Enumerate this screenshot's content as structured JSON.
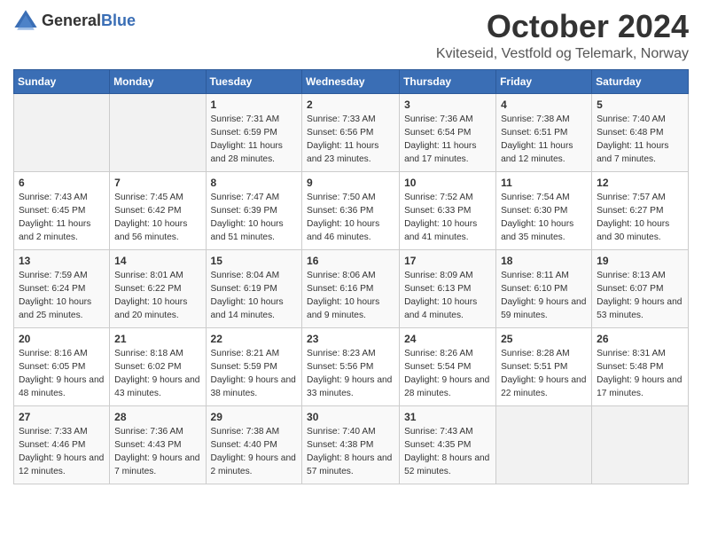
{
  "header": {
    "logo_general": "General",
    "logo_blue": "Blue",
    "month_title": "October 2024",
    "location": "Kviteseid, Vestfold og Telemark, Norway"
  },
  "weekdays": [
    "Sunday",
    "Monday",
    "Tuesday",
    "Wednesday",
    "Thursday",
    "Friday",
    "Saturday"
  ],
  "weeks": [
    [
      {
        "day": "",
        "info": ""
      },
      {
        "day": "",
        "info": ""
      },
      {
        "day": "1",
        "info": "Sunrise: 7:31 AM\nSunset: 6:59 PM\nDaylight: 11 hours and 28 minutes."
      },
      {
        "day": "2",
        "info": "Sunrise: 7:33 AM\nSunset: 6:56 PM\nDaylight: 11 hours and 23 minutes."
      },
      {
        "day": "3",
        "info": "Sunrise: 7:36 AM\nSunset: 6:54 PM\nDaylight: 11 hours and 17 minutes."
      },
      {
        "day": "4",
        "info": "Sunrise: 7:38 AM\nSunset: 6:51 PM\nDaylight: 11 hours and 12 minutes."
      },
      {
        "day": "5",
        "info": "Sunrise: 7:40 AM\nSunset: 6:48 PM\nDaylight: 11 hours and 7 minutes."
      }
    ],
    [
      {
        "day": "6",
        "info": "Sunrise: 7:43 AM\nSunset: 6:45 PM\nDaylight: 11 hours and 2 minutes."
      },
      {
        "day": "7",
        "info": "Sunrise: 7:45 AM\nSunset: 6:42 PM\nDaylight: 10 hours and 56 minutes."
      },
      {
        "day": "8",
        "info": "Sunrise: 7:47 AM\nSunset: 6:39 PM\nDaylight: 10 hours and 51 minutes."
      },
      {
        "day": "9",
        "info": "Sunrise: 7:50 AM\nSunset: 6:36 PM\nDaylight: 10 hours and 46 minutes."
      },
      {
        "day": "10",
        "info": "Sunrise: 7:52 AM\nSunset: 6:33 PM\nDaylight: 10 hours and 41 minutes."
      },
      {
        "day": "11",
        "info": "Sunrise: 7:54 AM\nSunset: 6:30 PM\nDaylight: 10 hours and 35 minutes."
      },
      {
        "day": "12",
        "info": "Sunrise: 7:57 AM\nSunset: 6:27 PM\nDaylight: 10 hours and 30 minutes."
      }
    ],
    [
      {
        "day": "13",
        "info": "Sunrise: 7:59 AM\nSunset: 6:24 PM\nDaylight: 10 hours and 25 minutes."
      },
      {
        "day": "14",
        "info": "Sunrise: 8:01 AM\nSunset: 6:22 PM\nDaylight: 10 hours and 20 minutes."
      },
      {
        "day": "15",
        "info": "Sunrise: 8:04 AM\nSunset: 6:19 PM\nDaylight: 10 hours and 14 minutes."
      },
      {
        "day": "16",
        "info": "Sunrise: 8:06 AM\nSunset: 6:16 PM\nDaylight: 10 hours and 9 minutes."
      },
      {
        "day": "17",
        "info": "Sunrise: 8:09 AM\nSunset: 6:13 PM\nDaylight: 10 hours and 4 minutes."
      },
      {
        "day": "18",
        "info": "Sunrise: 8:11 AM\nSunset: 6:10 PM\nDaylight: 9 hours and 59 minutes."
      },
      {
        "day": "19",
        "info": "Sunrise: 8:13 AM\nSunset: 6:07 PM\nDaylight: 9 hours and 53 minutes."
      }
    ],
    [
      {
        "day": "20",
        "info": "Sunrise: 8:16 AM\nSunset: 6:05 PM\nDaylight: 9 hours and 48 minutes."
      },
      {
        "day": "21",
        "info": "Sunrise: 8:18 AM\nSunset: 6:02 PM\nDaylight: 9 hours and 43 minutes."
      },
      {
        "day": "22",
        "info": "Sunrise: 8:21 AM\nSunset: 5:59 PM\nDaylight: 9 hours and 38 minutes."
      },
      {
        "day": "23",
        "info": "Sunrise: 8:23 AM\nSunset: 5:56 PM\nDaylight: 9 hours and 33 minutes."
      },
      {
        "day": "24",
        "info": "Sunrise: 8:26 AM\nSunset: 5:54 PM\nDaylight: 9 hours and 28 minutes."
      },
      {
        "day": "25",
        "info": "Sunrise: 8:28 AM\nSunset: 5:51 PM\nDaylight: 9 hours and 22 minutes."
      },
      {
        "day": "26",
        "info": "Sunrise: 8:31 AM\nSunset: 5:48 PM\nDaylight: 9 hours and 17 minutes."
      }
    ],
    [
      {
        "day": "27",
        "info": "Sunrise: 7:33 AM\nSunset: 4:46 PM\nDaylight: 9 hours and 12 minutes."
      },
      {
        "day": "28",
        "info": "Sunrise: 7:36 AM\nSunset: 4:43 PM\nDaylight: 9 hours and 7 minutes."
      },
      {
        "day": "29",
        "info": "Sunrise: 7:38 AM\nSunset: 4:40 PM\nDaylight: 9 hours and 2 minutes."
      },
      {
        "day": "30",
        "info": "Sunrise: 7:40 AM\nSunset: 4:38 PM\nDaylight: 8 hours and 57 minutes."
      },
      {
        "day": "31",
        "info": "Sunrise: 7:43 AM\nSunset: 4:35 PM\nDaylight: 8 hours and 52 minutes."
      },
      {
        "day": "",
        "info": ""
      },
      {
        "day": "",
        "info": ""
      }
    ]
  ]
}
